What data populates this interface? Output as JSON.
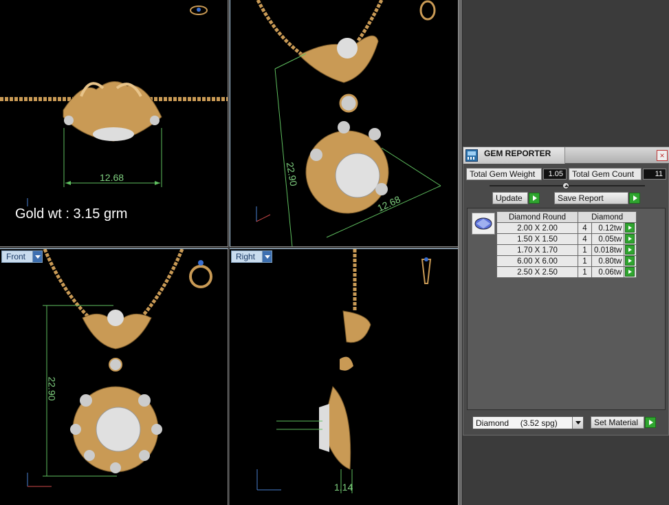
{
  "viewports": {
    "top": {
      "gold_weight": "Gold wt : 3.15 grm",
      "dimension": "12.68"
    },
    "perspective": {
      "dimension_height": "22.90",
      "dimension_width": "12.68"
    },
    "front": {
      "label": "Front",
      "dimension": "22.90"
    },
    "right": {
      "label": "Right",
      "dimension": "1.14"
    }
  },
  "gem_reporter": {
    "title": "GEM REPORTER",
    "close": "×",
    "total_weight_label": "Total Gem Weight",
    "total_weight_value": "1.05",
    "total_count_label": "Total Gem Count",
    "total_count_value": "11",
    "update_label": "Update",
    "save_report_label": "Save Report",
    "table_headers": [
      "Diamond Round",
      "Diamond"
    ],
    "rows": [
      {
        "size": "2.00 X 2.00",
        "count": "4",
        "weight": "0.12tw"
      },
      {
        "size": "1.50 X 1.50",
        "count": "4",
        "weight": "0.05tw"
      },
      {
        "size": "1.70 X 1.70",
        "count": "1",
        "weight": "0.018tw"
      },
      {
        "size": "6.00 X 6.00",
        "count": "1",
        "weight": "0.80tw"
      },
      {
        "size": "2.50 X 2.50",
        "count": "1",
        "weight": "0.06tw"
      }
    ],
    "material_select": "Diamond     (3.52 spg)",
    "set_material_label": "Set Material"
  },
  "colors": {
    "gold": "#c99a55",
    "dimension": "#5fbf5f",
    "viewport_bg": "#000000",
    "panel_bg": "#3b3b3b"
  }
}
